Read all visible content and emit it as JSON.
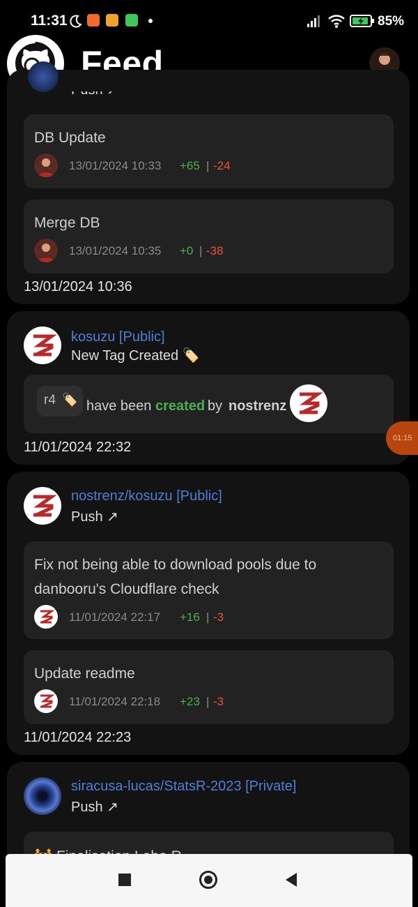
{
  "status": {
    "time": "11:31",
    "battery": "85%"
  },
  "header": {
    "title": "Feed"
  },
  "card1": {
    "event_partial": "Push ↗",
    "commits": [
      {
        "message": "DB Update",
        "date": "13/01/2024 10:33",
        "additions": "+65",
        "separator": "|",
        "deletions": "-24"
      },
      {
        "message": "Merge DB",
        "date": "13/01/2024 10:35",
        "additions": "+0",
        "separator": "|",
        "deletions": "-38"
      }
    ],
    "date": "13/01/2024 10:36"
  },
  "card2": {
    "repo": "kosuzu [Public]",
    "event": "New Tag Created 🏷️",
    "tag_name": "r4",
    "tag_emoji": "🏷️",
    "text_have_been": "have been",
    "text_created": "created",
    "text_by": "by",
    "username": "nostrenz",
    "date": "11/01/2024 22:32"
  },
  "floating_timer": {
    "label": "01:15"
  },
  "card3": {
    "repo": "nostrenz/kosuzu [Public]",
    "event": "Push ↗",
    "commits": [
      {
        "message_line1": "Fix not being able to download pools due to",
        "message_line2": "danbooru's Cloudflare check",
        "date": "11/01/2024 22:17",
        "additions": "+16",
        "separator": "|",
        "deletions": "-3"
      },
      {
        "message": "Update readme",
        "date": "11/01/2024 22:18",
        "additions": "+23",
        "separator": "|",
        "deletions": "-3"
      }
    ],
    "date": "11/01/2024 22:23"
  },
  "card4": {
    "repo": "siracusa-lucas/StatsR-2023 [Private]",
    "event": "Push ↗",
    "commit_partial": "🚧 Finalisation Labo R"
  },
  "colors": {
    "background": "#000000",
    "card": "#131313",
    "commit_card": "#222222",
    "link": "#4f7fd6",
    "additions": "#4caf50",
    "deletions": "#e8553e"
  }
}
